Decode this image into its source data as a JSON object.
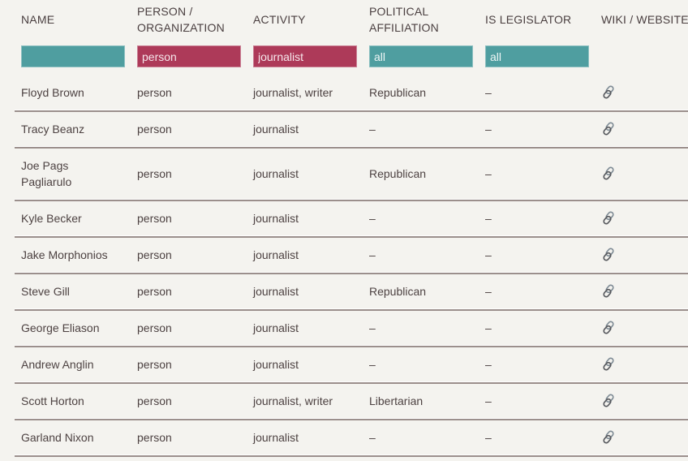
{
  "columns": [
    {
      "key": "name",
      "label": "NAME"
    },
    {
      "key": "type",
      "label": "PERSON / ORGANIZATION"
    },
    {
      "key": "activity",
      "label": "ACTIVITY"
    },
    {
      "key": "affiliation",
      "label": "POLITICAL AFFILIATION"
    },
    {
      "key": "legislator",
      "label": "IS LEGISLATOR"
    },
    {
      "key": "wiki",
      "label": "WIKI / WEBSITE"
    }
  ],
  "header_lines": {
    "name": [
      "NAME"
    ],
    "type": [
      "PERSON /",
      "ORGANIZATION"
    ],
    "activity": [
      "ACTIVITY"
    ],
    "affiliation": [
      "POLITICAL",
      "AFFILIATION"
    ],
    "legislator": [
      "IS LEGISLATOR"
    ],
    "wiki": [
      "WIKI / WEBSITE"
    ]
  },
  "filters": {
    "name": {
      "value": "",
      "color": "#4f9ea0"
    },
    "type": {
      "value": "person",
      "color": "#ad3a59"
    },
    "activity": {
      "value": "journalist",
      "color": "#ad3a59"
    },
    "affiliation": {
      "value": "all",
      "color": "#4f9ea0"
    },
    "legislator": {
      "value": "all",
      "color": "#4f9ea0"
    }
  },
  "rows": [
    {
      "name": "Floyd Brown",
      "type": "person",
      "activity": "journalist, writer",
      "affiliation": "Republican",
      "legislator": "–",
      "wiki": "link-icon"
    },
    {
      "name": "Tracy Beanz",
      "type": "person",
      "activity": "journalist",
      "affiliation": "–",
      "legislator": "–",
      "wiki": "link-icon"
    },
    {
      "name": "Joe Pags Pagliarulo",
      "name_lines": [
        "Joe Pags",
        "Pagliarulo"
      ],
      "type": "person",
      "activity": "journalist",
      "affiliation": "Republican",
      "legislator": "–",
      "wiki": "link-icon"
    },
    {
      "name": "Kyle Becker",
      "type": "person",
      "activity": "journalist",
      "affiliation": "–",
      "legislator": "–",
      "wiki": "link-icon"
    },
    {
      "name": "Jake Morphonios",
      "type": "person",
      "activity": "journalist",
      "affiliation": "–",
      "legislator": "–",
      "wiki": "link-icon"
    },
    {
      "name": "Steve Gill",
      "type": "person",
      "activity": "journalist",
      "affiliation": "Republican",
      "legislator": "–",
      "wiki": "link-icon"
    },
    {
      "name": "George Eliason",
      "type": "person",
      "activity": "journalist",
      "affiliation": "–",
      "legislator": "–",
      "wiki": "link-icon"
    },
    {
      "name": "Andrew Anglin",
      "type": "person",
      "activity": "journalist",
      "affiliation": "–",
      "legislator": "–",
      "wiki": "link-icon"
    },
    {
      "name": "Scott Horton",
      "type": "person",
      "activity": "journalist, writer",
      "affiliation": "Libertarian",
      "legislator": "–",
      "wiki": "link-icon"
    },
    {
      "name": "Garland Nixon",
      "type": "person",
      "activity": "journalist",
      "affiliation": "–",
      "legislator": "–",
      "wiki": "link-icon"
    }
  ]
}
